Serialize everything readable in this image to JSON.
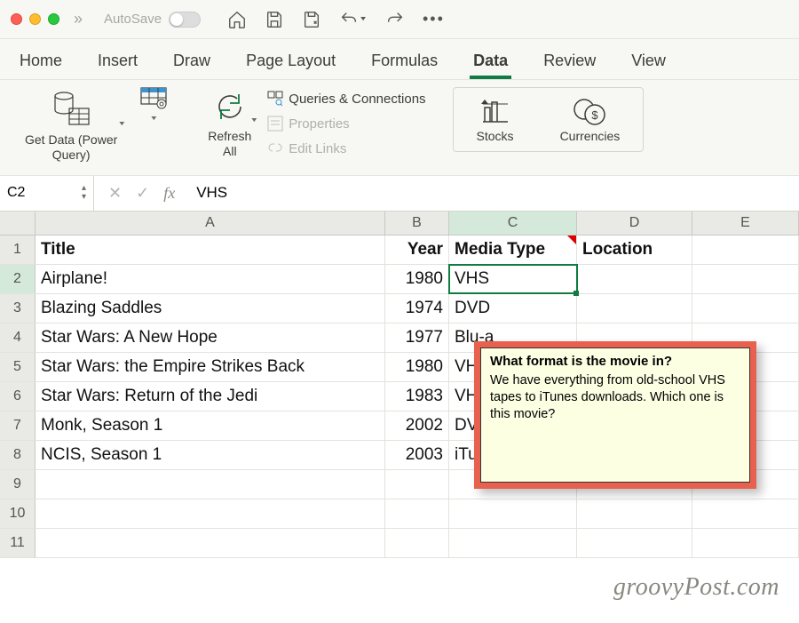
{
  "titlebar": {
    "autosave": "AutoSave"
  },
  "tabs": {
    "items": [
      "Home",
      "Insert",
      "Draw",
      "Page Layout",
      "Formulas",
      "Data",
      "Review",
      "View"
    ],
    "active": 5
  },
  "ribbon": {
    "getdata": "Get Data (Power\nQuery)",
    "refresh": "Refresh\nAll",
    "queries": "Queries & Connections",
    "properties": "Properties",
    "editlinks": "Edit Links",
    "stocks": "Stocks",
    "currencies": "Currencies"
  },
  "formula": {
    "name": "C2",
    "value": "VHS"
  },
  "columns": [
    "A",
    "B",
    "C",
    "D",
    "E"
  ],
  "headers": {
    "title": "Title",
    "year": "Year",
    "media": "Media Type",
    "location": "Location"
  },
  "rows": [
    {
      "t": "Airplane!",
      "y": "1980",
      "m": "VHS"
    },
    {
      "t": "Blazing Saddles",
      "y": "1974",
      "m": "DVD"
    },
    {
      "t": "Star Wars: A New Hope",
      "y": "1977",
      "m": "Blu-a"
    },
    {
      "t": "Star Wars: the Empire Strikes Back",
      "y": "1980",
      "m": "VHS"
    },
    {
      "t": "Star Wars: Return of the Jedi",
      "y": "1983",
      "m": "VHS"
    },
    {
      "t": "Monk, Season 1",
      "y": "2002",
      "m": "DVD"
    },
    {
      "t": "NCIS, Season 1",
      "y": "2003",
      "m": "iTunes"
    }
  ],
  "comment": {
    "title": "What format is the movie in?",
    "body": "We have everything from old-school VHS tapes to iTunes downloads. Which one is this movie?"
  },
  "watermark": "groovyPost.com"
}
